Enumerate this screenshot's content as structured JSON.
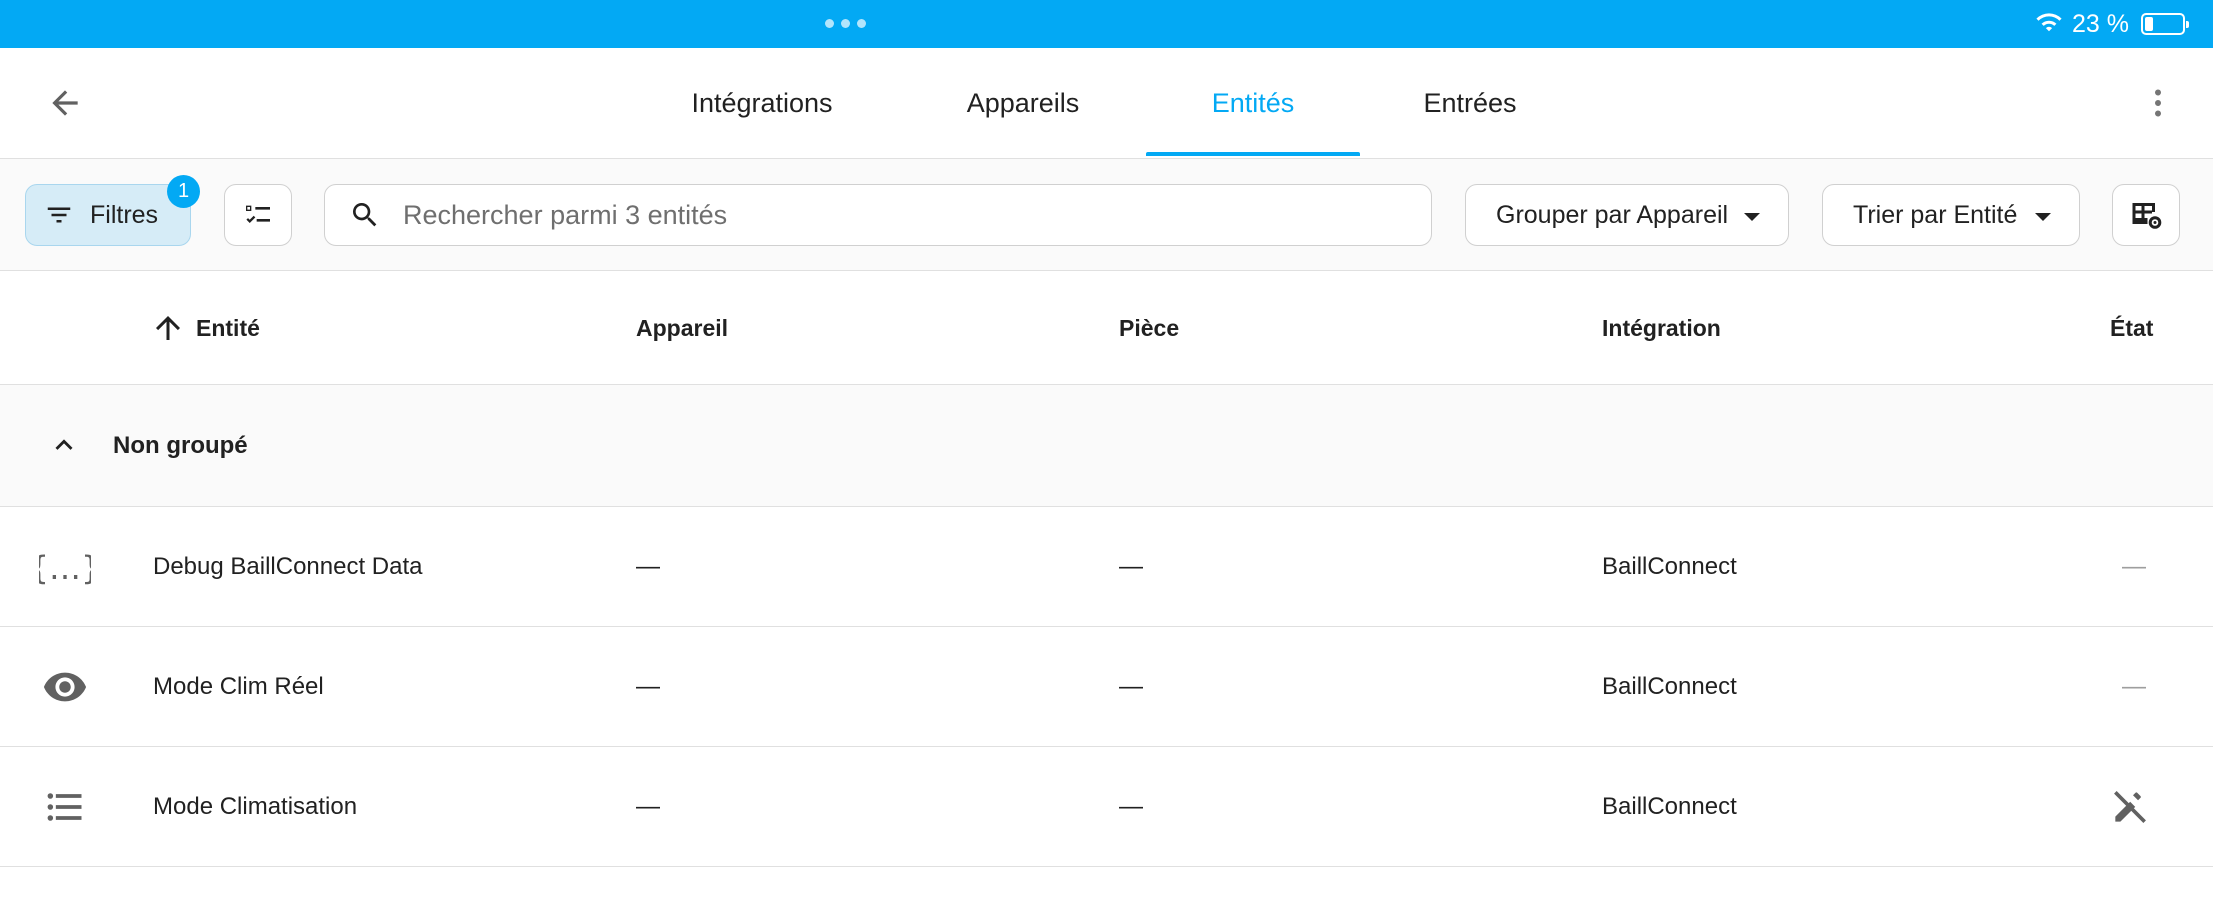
{
  "status_bar": {
    "battery_text": "23 %",
    "battery_level": 0.23,
    "icons": [
      "wifi-icon",
      "battery-icon"
    ]
  },
  "nav": {
    "tabs": [
      {
        "label": "Intégrations",
        "active": false
      },
      {
        "label": "Appareils",
        "active": false
      },
      {
        "label": "Entités",
        "active": true
      },
      {
        "label": "Entrées",
        "active": false
      }
    ],
    "icons": [
      "back-arrow-icon",
      "more-vertical-icon"
    ]
  },
  "toolbar": {
    "filters_label": "Filtres",
    "filters_count": "1",
    "search_placeholder": "Rechercher parmi 3 entités",
    "group_by_label": "Grouper par Appareil",
    "sort_by_label": "Trier par Entité"
  },
  "table": {
    "columns": [
      {
        "label": "Entité",
        "sorted": "ascending"
      },
      {
        "label": "Appareil"
      },
      {
        "label": "Pièce"
      },
      {
        "label": "Intégration"
      },
      {
        "label": "État"
      }
    ],
    "group": {
      "label": "Non groupé",
      "expanded": true
    },
    "rows": [
      {
        "icon": "code-json-icon",
        "entity": "Debug BaillConnect Data",
        "device": "—",
        "area": "—",
        "integration": "BaillConnect",
        "state": "—"
      },
      {
        "icon": "eye-icon",
        "entity": "Mode Clim Réel",
        "device": "—",
        "area": "—",
        "integration": "BaillConnect",
        "state": "—"
      },
      {
        "icon": "format-list-bulleted-icon",
        "entity": "Mode Climatisation",
        "device": "—",
        "area": "—",
        "integration": "BaillConnect",
        "state_icon": "pencil-off-icon"
      }
    ]
  },
  "colors": {
    "accent": "#03a9f4",
    "filter_chip_bg": "#d6ecf7",
    "icon_gray": "#616161"
  }
}
